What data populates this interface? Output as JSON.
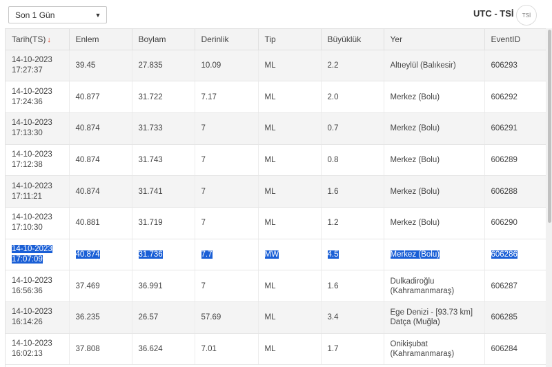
{
  "filter": {
    "selected": "Son 1 Gün"
  },
  "timezone": {
    "label": "UTC - TSİ",
    "toggle_text": "TSİ"
  },
  "table": {
    "columns": [
      "Tarih(TS)",
      "Enlem",
      "Boylam",
      "Derinlik",
      "Tip",
      "Büyüklük",
      "Yer",
      "EventID"
    ],
    "sort_indicator": "↓",
    "rows": [
      {
        "date": "14-10-2023",
        "time": "17:27:37",
        "lat": "39.45",
        "lon": "27.835",
        "depth": "10.09",
        "type": "ML",
        "mag": "2.2",
        "place1": "Altıeylül (Balıkesir)",
        "place2": "",
        "id": "606293"
      },
      {
        "date": "14-10-2023",
        "time": "17:24:36",
        "lat": "40.877",
        "lon": "31.722",
        "depth": "7.17",
        "type": "ML",
        "mag": "2.0",
        "place1": "Merkez (Bolu)",
        "place2": "",
        "id": "606292"
      },
      {
        "date": "14-10-2023",
        "time": "17:13:30",
        "lat": "40.874",
        "lon": "31.733",
        "depth": "7",
        "type": "ML",
        "mag": "0.7",
        "place1": "Merkez (Bolu)",
        "place2": "",
        "id": "606291"
      },
      {
        "date": "14-10-2023",
        "time": "17:12:38",
        "lat": "40.874",
        "lon": "31.743",
        "depth": "7",
        "type": "ML",
        "mag": "0.8",
        "place1": "Merkez (Bolu)",
        "place2": "",
        "id": "606289"
      },
      {
        "date": "14-10-2023",
        "time": "17:11:21",
        "lat": "40.874",
        "lon": "31.741",
        "depth": "7",
        "type": "ML",
        "mag": "1.6",
        "place1": "Merkez (Bolu)",
        "place2": "",
        "id": "606288"
      },
      {
        "date": "14-10-2023",
        "time": "17:10:30",
        "lat": "40.881",
        "lon": "31.719",
        "depth": "7",
        "type": "ML",
        "mag": "1.2",
        "place1": "Merkez (Bolu)",
        "place2": "",
        "id": "606290"
      },
      {
        "date": "14-10-2023",
        "time": "17:07:09",
        "lat": "40.874",
        "lon": "31.736",
        "depth": "7.7",
        "type": "MW",
        "mag": "4.5",
        "place1": "Merkez (Bolu)",
        "place2": "",
        "id": "606286"
      },
      {
        "date": "14-10-2023",
        "time": "16:56:36",
        "lat": "37.469",
        "lon": "36.991",
        "depth": "7",
        "type": "ML",
        "mag": "1.6",
        "place1": "Dulkadiroğlu",
        "place2": "(Kahramanmaraş)",
        "id": "606287"
      },
      {
        "date": "14-10-2023",
        "time": "16:14:26",
        "lat": "36.235",
        "lon": "26.57",
        "depth": "57.69",
        "type": "ML",
        "mag": "3.4",
        "place1": "Ege Denizi - [93.73 km]",
        "place2": "Datça (Muğla)",
        "id": "606285"
      },
      {
        "date": "14-10-2023",
        "time": "16:02:13",
        "lat": "37.808",
        "lon": "36.624",
        "depth": "7.01",
        "type": "ML",
        "mag": "1.7",
        "place1": "Onikişubat",
        "place2": "(Kahramanmaraş)",
        "id": "606284"
      }
    ]
  }
}
